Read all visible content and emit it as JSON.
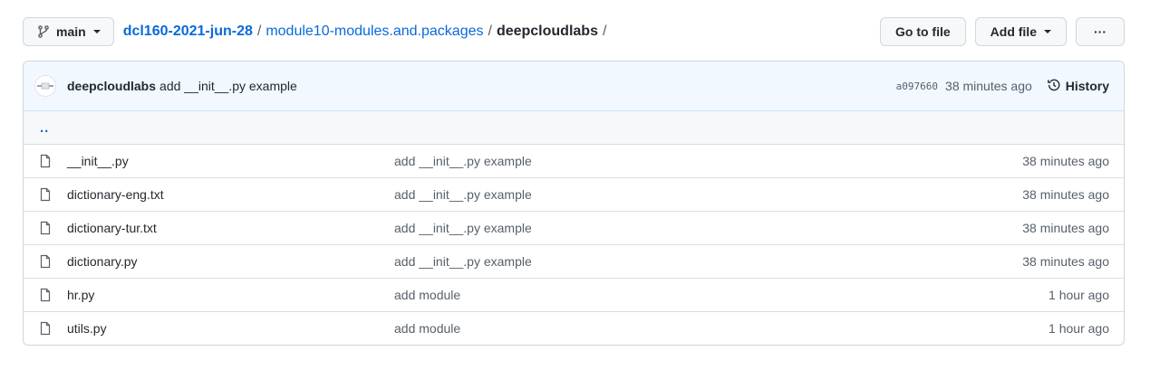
{
  "branch": {
    "name": "main"
  },
  "breadcrumb": {
    "repo": "dcl160-2021-jun-28",
    "folder": "module10-modules.and.packages",
    "current": "deepcloudlabs",
    "separator": "/"
  },
  "actions": {
    "go_to_file": "Go to file",
    "add_file": "Add file",
    "more": "···"
  },
  "latest_commit": {
    "author": "deepcloudlabs",
    "message": "add __init__.py example",
    "sha": "a097660",
    "time": "38 minutes ago",
    "history_label": "History"
  },
  "parent_dir": "..",
  "files": [
    {
      "name": "__init__.py",
      "message": "add __init__.py example",
      "time": "38 minutes ago"
    },
    {
      "name": "dictionary-eng.txt",
      "message": "add __init__.py example",
      "time": "38 minutes ago"
    },
    {
      "name": "dictionary-tur.txt",
      "message": "add __init__.py example",
      "time": "38 minutes ago"
    },
    {
      "name": "dictionary.py",
      "message": "add __init__.py example",
      "time": "38 minutes ago"
    },
    {
      "name": "hr.py",
      "message": "add module",
      "time": "1 hour ago"
    },
    {
      "name": "utils.py",
      "message": "add module",
      "time": "1 hour ago"
    }
  ],
  "colors": {
    "link": "#0969da",
    "text": "#24292f",
    "muted": "#57606a",
    "commit_bar": "#f1f8ff"
  }
}
